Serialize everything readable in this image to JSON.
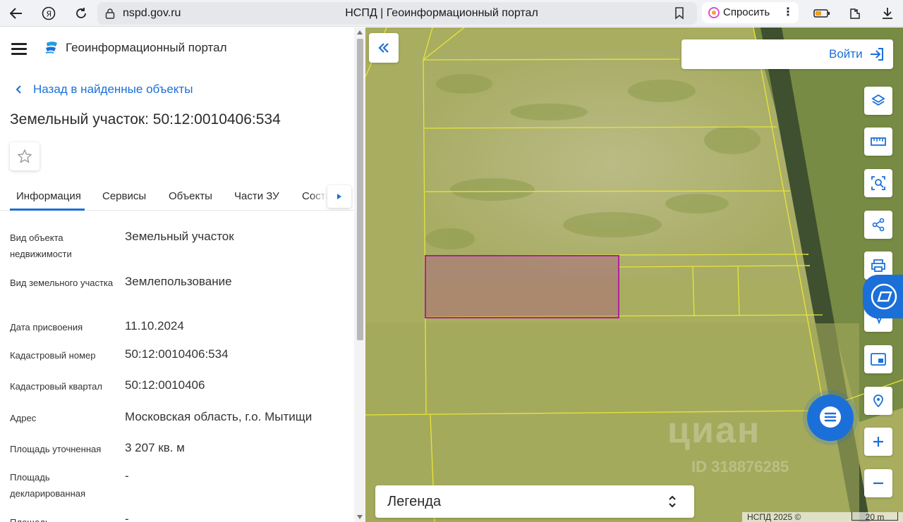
{
  "browser": {
    "url": "nspd.gov.ru",
    "page_title": "НСПД | Геоинформационный портал",
    "ask_label": "Спросить"
  },
  "header": {
    "app_name": "Геоинформационный портал"
  },
  "nav": {
    "back_label": "Назад в найденные объекты"
  },
  "object": {
    "title": "Земельный участок: 50:12:0010406:534"
  },
  "tabs": [
    {
      "label": "Информация",
      "active": true
    },
    {
      "label": "Сервисы"
    },
    {
      "label": "Объекты"
    },
    {
      "label": "Части ЗУ"
    },
    {
      "label": "Соста"
    }
  ],
  "info_rows": [
    {
      "label": "Вид объекта недвижимости",
      "value": "Земельный участок"
    },
    {
      "label": "Вид земельного участка",
      "value": "Землепользование"
    },
    {
      "label": "Дата присвоения",
      "value": "11.10.2024"
    },
    {
      "label": "Кадастровый номер",
      "value": "50:12:0010406:534"
    },
    {
      "label": "Кадастровый квартал",
      "value": "50:12:0010406"
    },
    {
      "label": "Адрес",
      "value": "Московская область, г.о. Мытищи"
    },
    {
      "label": "Площадь уточненная",
      "value": "3 207 кв. м"
    },
    {
      "label": "Площадь декларированная",
      "value": "-"
    },
    {
      "label": "Площадь",
      "value": "-"
    }
  ],
  "map": {
    "login_label": "Войти",
    "legend_label": "Легенда",
    "attribution": "НСПД 2025 ©",
    "scale_label": "20 m",
    "watermark": "циан",
    "watermark_id": "ID 318876285",
    "selected_parcel_color": "#b0209a",
    "boundary_color": "#e8e43a"
  },
  "colors": {
    "accent": "#1b6fd8"
  }
}
